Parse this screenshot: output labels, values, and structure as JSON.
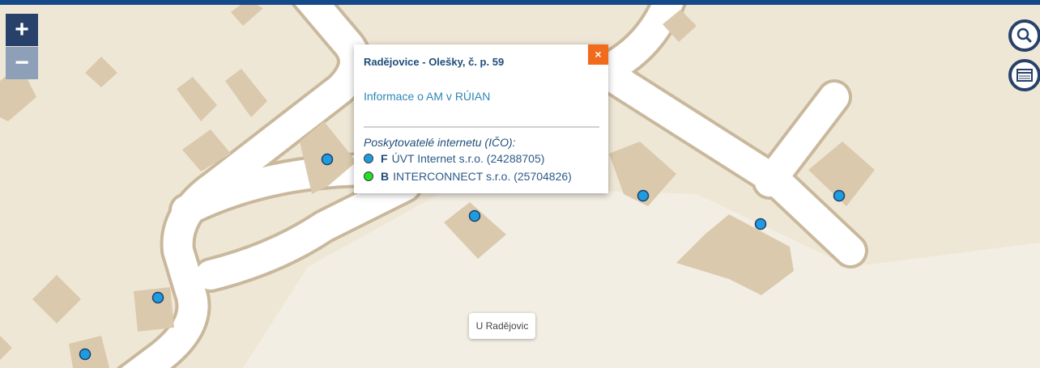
{
  "map": {
    "background_color": "#efe7d6",
    "road_color": "#ffffff",
    "road_edge_color": "#c9b89c",
    "building_color": "#dac9ac",
    "point_color": "#1f9be0"
  },
  "controls": {
    "zoom_in_label": "+",
    "zoom_out_label": "−",
    "search_icon": "search-icon",
    "table_icon": "table-icon"
  },
  "popup": {
    "title": "Radějovice - Olešky, č. p. 59",
    "close_label": "×",
    "info_link": "Informace o AM v RÚIAN",
    "providers_title": "Poskytovatelé internetu (IČO):",
    "providers": [
      {
        "code": "F",
        "name": "ÚVT Internet s.r.o. (24288705)",
        "color": "#1f9be0"
      },
      {
        "code": "B",
        "name": "INTERCONNECT s.r.o. (25704826)",
        "color": "#22e022"
      }
    ]
  },
  "street_label": "U Radějovic"
}
